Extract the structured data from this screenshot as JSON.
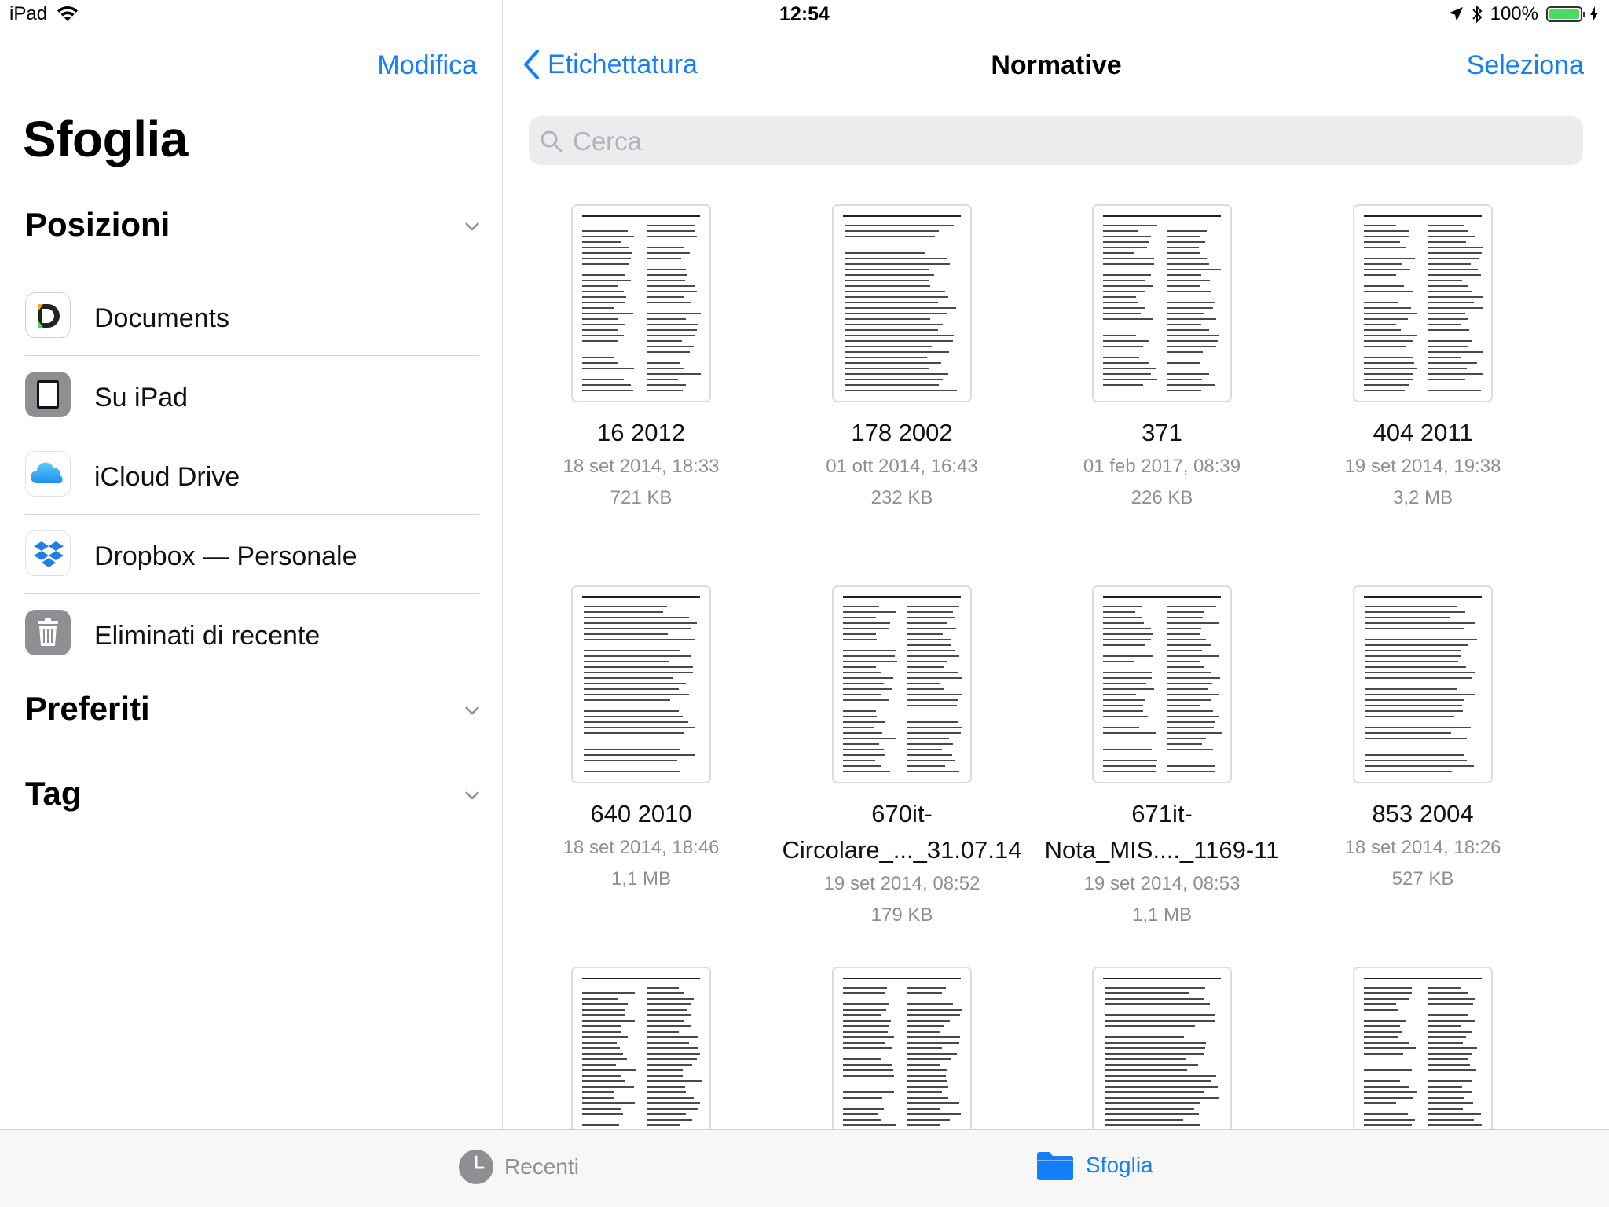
{
  "status": {
    "device": "iPad",
    "time": "12:54",
    "battery": "100%",
    "battery_level": 1.0
  },
  "sidebar": {
    "edit_label": "Modifica",
    "title": "Sfoglia",
    "sections": {
      "locations": "Posizioni",
      "favorites": "Preferiti",
      "tags": "Tag"
    },
    "locations": [
      {
        "label": "Documents",
        "icon": "documents-app-icon"
      },
      {
        "label": "Su iPad",
        "icon": "ipad-icon"
      },
      {
        "label": "iCloud Drive",
        "icon": "icloud-icon"
      },
      {
        "label": "Dropbox — Personale",
        "icon": "dropbox-icon"
      },
      {
        "label": "Eliminati di recente",
        "icon": "trash-icon"
      }
    ]
  },
  "nav": {
    "back_label": "Etichettatura",
    "title": "Normative",
    "select_label": "Seleziona"
  },
  "search": {
    "placeholder": "Cerca"
  },
  "files": [
    {
      "name": "16 2012",
      "date": "18 set 2014, 18:33",
      "size": "721 KB"
    },
    {
      "name": "178 2002",
      "date": "01 ott 2014, 16:43",
      "size": "232 KB"
    },
    {
      "name": "371",
      "date": "01 feb 2017, 08:39",
      "size": "226 KB"
    },
    {
      "name": "404 2011",
      "date": "19 set 2014, 19:38",
      "size": "3,2 MB"
    },
    {
      "name": "640 2010",
      "date": "18 set 2014, 18:46",
      "size": "1,1 MB"
    },
    {
      "name": "670it-\nCircolare_..._31.07.14",
      "date": "19 set 2014, 08:52",
      "size": "179 KB"
    },
    {
      "name": "671it-\nNota_MIS...._1169-11",
      "date": "19 set 2014, 08:53",
      "size": "1,1 MB"
    },
    {
      "name": "853 2004",
      "date": "18 set 2014, 18:26",
      "size": "527 KB"
    },
    {
      "name": "",
      "date": "",
      "size": ""
    },
    {
      "name": "",
      "date": "",
      "size": ""
    },
    {
      "name": "",
      "date": "",
      "size": ""
    },
    {
      "name": "",
      "date": "",
      "size": ""
    }
  ],
  "tabbar": {
    "recents_label": "Recenti",
    "browse_label": "Sfoglia"
  },
  "colors": {
    "accent": "#157efb",
    "secondary_text": "#8e8e93",
    "battery": "#4cd964"
  }
}
